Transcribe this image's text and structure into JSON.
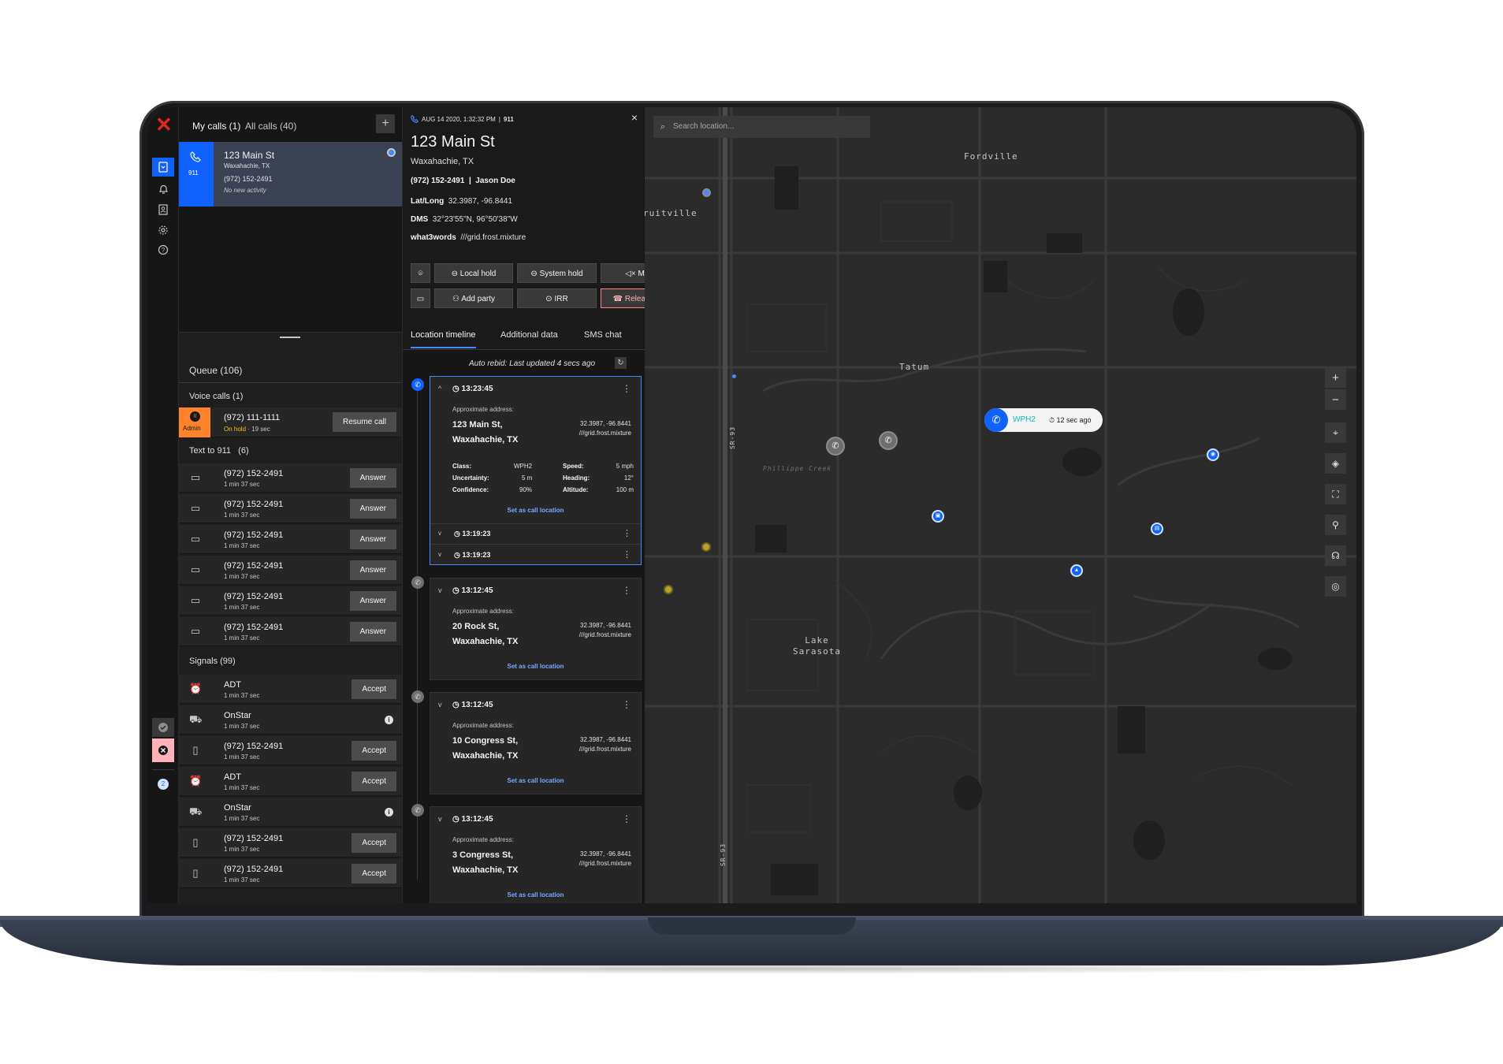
{
  "rail": {
    "logo": "✕",
    "bottom_badge": "2"
  },
  "calls": {
    "tab_my": "My calls (1)",
    "tab_all": "All calls (40)",
    "add": "+",
    "active_call": {
      "address": "123 Main St",
      "city": "Waxahachie, TX",
      "phone": "(972) 152-2491",
      "activity": "No new activity",
      "badge": "911"
    },
    "queue_title": "Queue (106)",
    "voice_title": "Voice calls (1)",
    "voice": [
      {
        "phone": "(972) 111-1111",
        "status": "On hold",
        "duration": "· 19 sec",
        "tag": "Admin",
        "action": "Resume call"
      }
    ],
    "text_title": "Text to 911",
    "text_count": "(6)",
    "texts": [
      {
        "phone": "(972) 152-2491",
        "time": "1 min 37 sec",
        "action": "Answer"
      },
      {
        "phone": "(972) 152-2491",
        "time": "1 min 37 sec",
        "action": "Answer"
      },
      {
        "phone": "(972) 152-2491",
        "time": "1 min 37 sec",
        "action": "Answer"
      },
      {
        "phone": "(972) 152-2491",
        "time": "1 min 37 sec",
        "action": "Answer"
      },
      {
        "phone": "(972) 152-2491",
        "time": "1 min 37 sec",
        "action": "Answer"
      },
      {
        "phone": "(972) 152-2491",
        "time": "1 min 37 sec",
        "action": "Answer"
      }
    ],
    "signals_title": "Signals (99)",
    "signals": [
      {
        "name": "ADT",
        "time": "1 min 37 sec",
        "action": "Accept",
        "icon": "alarm-icon"
      },
      {
        "name": "OnStar",
        "time": "1 min 37 sec",
        "action": "",
        "icon": "car-icon"
      },
      {
        "name": "(972) 152-2491",
        "time": "1 min 37 sec",
        "action": "Accept",
        "icon": "mobile-icon"
      },
      {
        "name": "ADT",
        "time": "1 min 37 sec",
        "action": "Accept",
        "icon": "alarm-icon"
      },
      {
        "name": "OnStar",
        "time": "1 min 37 sec",
        "action": "",
        "icon": "car-icon"
      },
      {
        "name": "(972) 152-2491",
        "time": "1 min 37 sec",
        "action": "Accept",
        "icon": "mobile-icon"
      },
      {
        "name": "(972) 152-2491",
        "time": "1 min 37 sec",
        "action": "Accept",
        "icon": "mobile-icon"
      }
    ]
  },
  "detail": {
    "header": "AUG 14 2020, 1:32:32 PM",
    "header_sep": "|",
    "header_code": "911",
    "close": "×",
    "title": "123 Main St",
    "city": "Waxahachie, TX",
    "caller": "(972) 152-2491  |  Jason Doe",
    "latlong_label": "Lat/Long",
    "latlong": "32.3987, -96.8441",
    "dms_label": "DMS",
    "dms": "32°23'55\"N, 96°50'38\"W",
    "w3w_label": "what3words",
    "w3w": "///grid.frost.mixture",
    "buttons": {
      "local_hold": "Local hold",
      "system_hold": "System hold",
      "mute": "Mute",
      "add_party": "Add party",
      "irr": "IRR",
      "release": "Release call"
    },
    "tabs": [
      "Location timeline",
      "Additional data",
      "SMS chat"
    ],
    "auto_rebid": "Auto rebid: Last updated 4 secs ago",
    "cards": [
      {
        "time": "13:23:45",
        "label": "Approximate address:",
        "address_1": "123 Main St,",
        "address_2": "Waxahachie, TX",
        "coord": "32.3987, -96.8441",
        "w3w": "///grid.frost.mixture",
        "details": {
          "class_label": "Class:",
          "class": "WPH2",
          "unc_label": "Uncertainty:",
          "unc": "5 m",
          "conf_label": "Confidence:",
          "conf": "90%",
          "speed_label": "Speed:",
          "speed": "5 mph",
          "heading_label": "Heading:",
          "heading": "12°",
          "alt_label": "Altitude:",
          "alt": "100 m"
        },
        "link": "Set as call location",
        "sub1": "13:19:23",
        "sub2": "13:19:23"
      },
      {
        "time": "13:12:45",
        "label": "Approximate address:",
        "address_1": "20 Rock St,",
        "address_2": "Waxahachie, TX",
        "coord": "32.3987, -96.8441",
        "w3w": "///grid.frost.mixture",
        "link": "Set as call location"
      },
      {
        "time": "13:12:45",
        "label": "Approximate address:",
        "address_1": "10 Congress St,",
        "address_2": "Waxahachie, TX",
        "coord": "32.3987, -96.8441",
        "w3w": "///grid.frost.mixture",
        "link": "Set as call location"
      },
      {
        "time": "13:12:45",
        "label": "Approximate address:",
        "address_1": "3 Congress St,",
        "address_2": "Waxahachie, TX",
        "coord": "32.3987, -96.8441",
        "w3w": "///grid.frost.mixture",
        "link": "Set as call location"
      }
    ]
  },
  "map": {
    "search_placeholder": "Search location...",
    "labels": [
      "Fordville",
      "ruitville",
      "Tatum",
      "Lake\nSarasota",
      "SR-93",
      "SR-93",
      "Phillippe Creek"
    ],
    "callout": {
      "class": "WPH2",
      "age": "12 sec ago"
    },
    "colors": {
      "accent": "#0f62fe",
      "danger": "#da1e28",
      "hold": "#f1c21b"
    }
  }
}
